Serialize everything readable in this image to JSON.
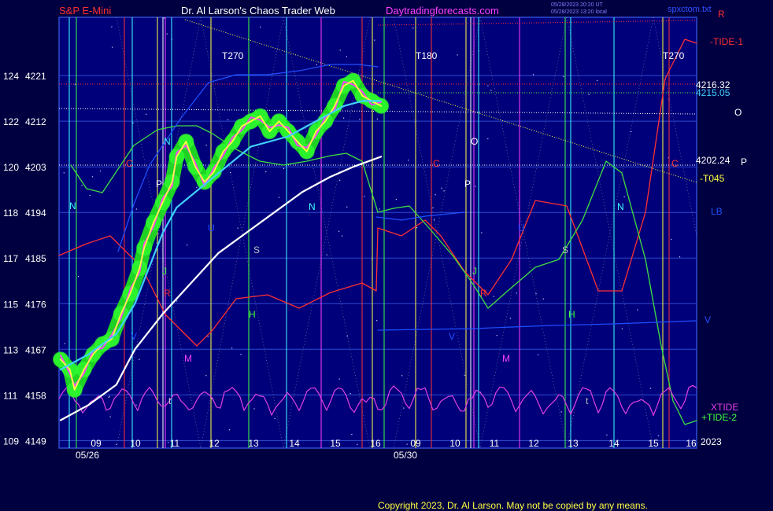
{
  "header": {
    "instrument": "S&P E-Mini",
    "author": "Dr. Al Larson's Chaos Trader Web",
    "site": "Daytradingforecasts.com",
    "stamp1": "05/28/2023 20:20 UT",
    "stamp2": "05/28/2023 13:20 local",
    "file": "spxctom.txt"
  },
  "footer": {
    "copyright": "Copyright 2023, Dr. Al Larson. May not be copied by any means."
  },
  "colors": {
    "background": "#000040",
    "plot_bg": "#00007a",
    "grid": "#2d4bd0",
    "price": "#ffff40",
    "halo": "#20dd20",
    "avg_cyan": "#40d0ff",
    "white_line": "#ffffff",
    "tide1": "#ff3030",
    "tide2": "#40e040",
    "xtide": "#e040e0",
    "blue_line": "#2050ff"
  },
  "chart_data": {
    "type": "line",
    "title": "S&P E-Mini",
    "y_ticks": [
      {
        "left": "124",
        "right": "4221",
        "value": 4221
      },
      {
        "left": "122",
        "right": "4212",
        "value": 4212
      },
      {
        "left": "120",
        "right": "4203",
        "value": 4203
      },
      {
        "left": "118",
        "right": "4194",
        "value": 4194
      },
      {
        "left": "117",
        "right": "4185",
        "value": 4185
      },
      {
        "left": "115",
        "right": "4176",
        "value": 4176
      },
      {
        "left": "113",
        "right": "4167",
        "value": 4167
      },
      {
        "left": "111",
        "right": "4158",
        "value": 4158
      },
      {
        "left": "109",
        "right": "4149",
        "value": 4149
      }
    ],
    "ylim": [
      4147.5,
      4232.5
    ],
    "x_hours": [
      "09",
      "10",
      "11",
      "12",
      "13",
      "14",
      "15",
      "16",
      "09",
      "10",
      "11",
      "12",
      "13",
      "14",
      "15",
      "16"
    ],
    "x_dates": [
      "05/26",
      "05/30"
    ],
    "x_year": "2023",
    "price_levels": [
      {
        "label": "4216.32",
        "value": 4216.3
      },
      {
        "label": "4215.05",
        "value": 4215.05
      },
      {
        "label": "4202.24",
        "value": 4202.24
      }
    ],
    "right_labels": [
      "R",
      "-TIDE-1",
      "O",
      "P",
      "-T045",
      "LB",
      "V",
      "XTIDE",
      "+TIDE-2"
    ],
    "mid_labels": [
      "T270",
      "T180",
      "T270",
      "O",
      "P",
      "C",
      "C",
      "C",
      "N",
      "N",
      "N",
      "N",
      "U",
      "U",
      "S",
      "S",
      "J",
      "J",
      "R",
      "R",
      "H",
      "H",
      "M",
      "M",
      "V",
      "V",
      "t",
      "t"
    ],
    "series": [
      {
        "type": "ohlc",
        "color": "#ffff40",
        "points": [
          [
            0,
            4165
          ],
          [
            2,
            4163
          ],
          [
            3,
            4159
          ],
          [
            5,
            4163
          ],
          [
            7,
            4166
          ],
          [
            9,
            4168
          ],
          [
            11,
            4169
          ],
          [
            13,
            4174
          ],
          [
            15,
            4178
          ],
          [
            17,
            4183
          ],
          [
            18,
            4187
          ],
          [
            20,
            4192
          ],
          [
            22,
            4196
          ],
          [
            24,
            4200
          ],
          [
            25,
            4205
          ],
          [
            27,
            4208
          ],
          [
            29,
            4203
          ],
          [
            31,
            4200
          ],
          [
            33,
            4202
          ],
          [
            35,
            4206
          ],
          [
            37,
            4208
          ],
          [
            39,
            4211
          ],
          [
            41,
            4212
          ],
          [
            43,
            4213
          ],
          [
            45,
            4210
          ],
          [
            47,
            4212
          ],
          [
            49,
            4210
          ],
          [
            51,
            4208
          ],
          [
            53,
            4206
          ],
          [
            55,
            4210
          ],
          [
            57,
            4212
          ],
          [
            59,
            4215
          ],
          [
            61,
            4219
          ],
          [
            63,
            4220
          ],
          [
            65,
            4217
          ],
          [
            67,
            4216
          ],
          [
            69,
            4215
          ]
        ]
      },
      {
        "type": "line",
        "color": "#40d0ff",
        "points": [
          [
            0,
            4163
          ],
          [
            6,
            4166
          ],
          [
            12,
            4170
          ],
          [
            16,
            4176
          ],
          [
            19,
            4183
          ],
          [
            22,
            4190
          ],
          [
            25,
            4195
          ],
          [
            29,
            4198
          ],
          [
            33,
            4201
          ],
          [
            37,
            4204
          ],
          [
            41,
            4207
          ],
          [
            45,
            4208
          ],
          [
            49,
            4209
          ],
          [
            53,
            4211
          ],
          [
            57,
            4213
          ],
          [
            61,
            4215
          ],
          [
            65,
            4216
          ],
          [
            69,
            4216
          ]
        ]
      },
      {
        "type": "line",
        "color": "#ffffff",
        "points": [
          [
            0,
            4153
          ],
          [
            6,
            4156
          ],
          [
            12,
            4160
          ],
          [
            16,
            4167
          ],
          [
            22,
            4174
          ],
          [
            28,
            4180
          ],
          [
            34,
            4186
          ],
          [
            40,
            4190
          ],
          [
            46,
            4194
          ],
          [
            52,
            4198
          ],
          [
            58,
            4201
          ],
          [
            63,
            4203
          ],
          [
            69,
            4205
          ]
        ]
      }
    ]
  }
}
